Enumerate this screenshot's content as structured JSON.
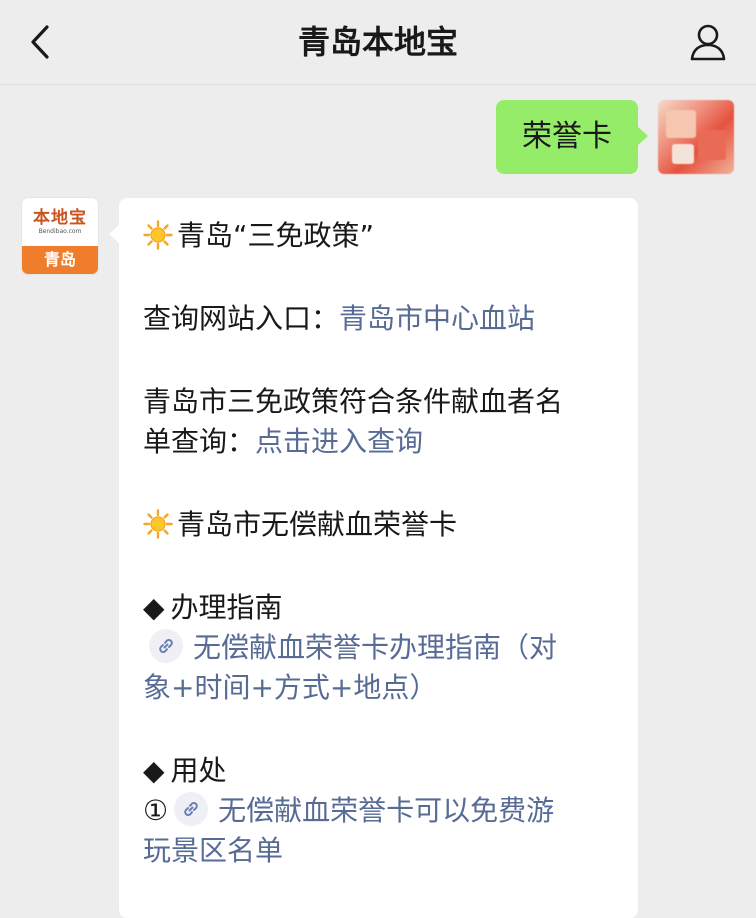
{
  "header": {
    "title": "青岛本地宝",
    "back_icon": "chevron-left-icon",
    "profile_icon": "person-icon"
  },
  "outgoing": {
    "text": "荣誉卡",
    "bubble_color": "#95ec69"
  },
  "bot_avatar": {
    "brand": "本地宝",
    "url": "Bendibao.com",
    "city": "青岛"
  },
  "reply": {
    "line1": "青岛“三免政策”",
    "query_label": "查询网站入口：",
    "query_link": "青岛市中心血站",
    "list_text_a": "青岛市三免政策符合条件献血者名",
    "list_text_b": "单查询：",
    "list_link": "点击进入查询",
    "section2_title": "青岛市无偿献血荣誉卡",
    "guide_title": "办理指南",
    "guide_link_a": "无偿献血荣誉卡办理指南（对",
    "guide_link_b": "象+时间+方式+地点）",
    "use_title": "用处",
    "use_num": "①",
    "use_link_a": "无偿献血荣誉卡可以免费游",
    "use_link_b": "玩景区名单",
    "diamond": "◆",
    "link_color": "#576b95"
  }
}
